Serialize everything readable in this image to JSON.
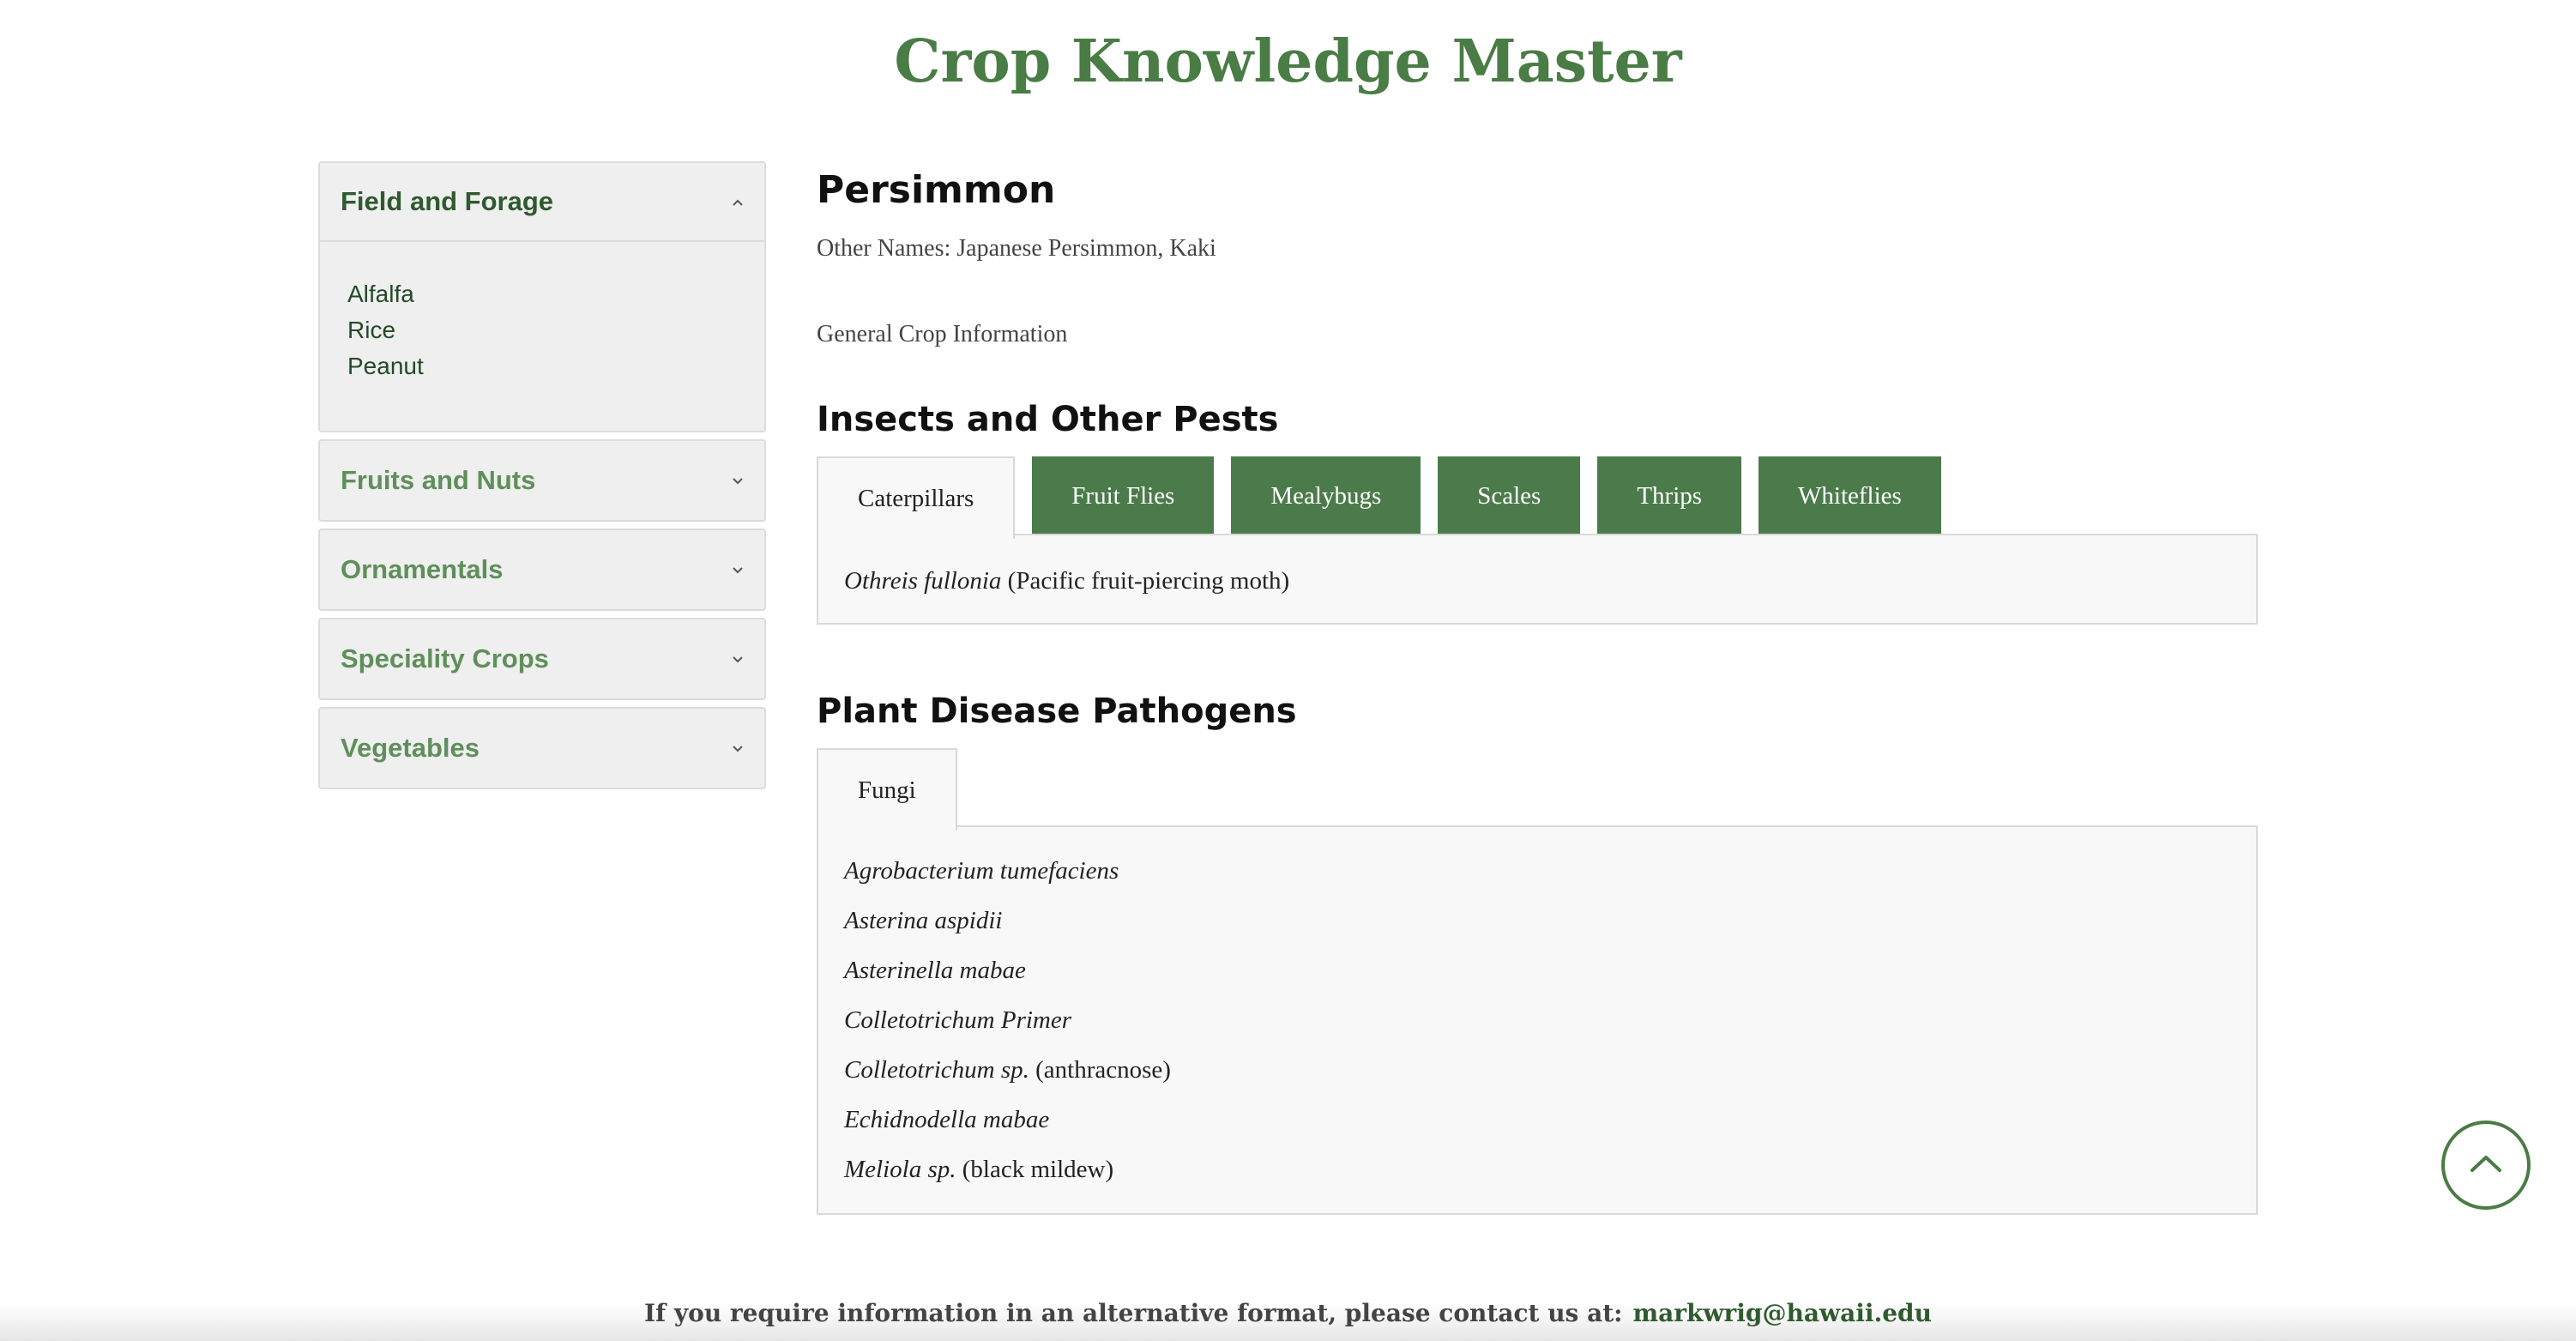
{
  "site_title": "Crop Knowledge Master",
  "sidebar": {
    "categories": [
      {
        "label": "Field and Forage",
        "expanded": true,
        "items": [
          "Alfalfa",
          "Rice",
          "Peanut"
        ]
      },
      {
        "label": "Fruits and Nuts",
        "expanded": false
      },
      {
        "label": "Ornamentals",
        "expanded": false
      },
      {
        "label": "Speciality Crops",
        "expanded": false
      },
      {
        "label": "Vegetables",
        "expanded": false
      }
    ]
  },
  "crop": {
    "name": "Persimmon",
    "other_names": "Other Names: Japanese Persimmon, Kaki",
    "general_info_link": "General Crop Information"
  },
  "pests": {
    "heading": "Insects and Other Pests",
    "tabs": [
      "Caterpillars",
      "Fruit Flies",
      "Mealybugs",
      "Scales",
      "Thrips",
      "Whiteflies"
    ],
    "active_tab": "Caterpillars",
    "entries": [
      {
        "scientific": "Othreis fullonia",
        "common": "(Pacific fruit-piercing moth)"
      }
    ]
  },
  "diseases": {
    "heading": "Plant Disease Pathogens",
    "tabs": [
      "Fungi"
    ],
    "active_tab": "Fungi",
    "entries": [
      {
        "scientific": "Agrobacterium tumefaciens",
        "common": ""
      },
      {
        "scientific": "Asterina aspidii",
        "common": ""
      },
      {
        "scientific": "Asterinella mabae",
        "common": ""
      },
      {
        "scientific": "Colletotrichum Primer",
        "common": ""
      },
      {
        "scientific": "Colletotrichum sp.",
        "common": "(anthracnose)"
      },
      {
        "scientific": "Echidnodella mabae",
        "common": ""
      },
      {
        "scientific": "Meliola sp.",
        "common": "(black mildew)"
      }
    ]
  },
  "footer": {
    "text": "If you require information in an alternative format, please contact us at:",
    "email": "markwrig@hawaii.edu"
  },
  "icons": {
    "scroll_top": "chevron-up-icon",
    "accordion_open": "chevron-up-icon",
    "accordion_closed": "chevron-down-icon"
  },
  "colors": {
    "brand_green": "#4a7c45",
    "tab_green": "#4b7b4a",
    "panel_bg": "#f8f8f8"
  }
}
